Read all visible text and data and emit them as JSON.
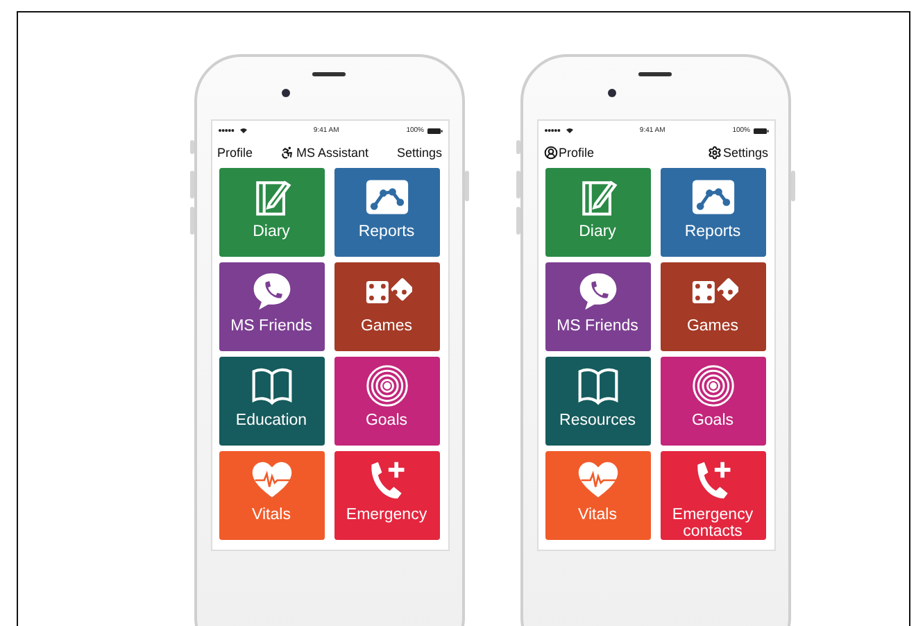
{
  "phones": [
    {
      "status": {
        "time": "9:41 AM",
        "battery": "100%"
      },
      "header": [
        {
          "text": "Profile",
          "kind": "plain"
        },
        {
          "text": "MS Assistant",
          "kind": "accessibility"
        },
        {
          "text": "Settings",
          "kind": "plain"
        }
      ],
      "tiles": [
        {
          "label": "Diary",
          "kind": "diary",
          "color": "#2a8a46"
        },
        {
          "label": "Reports",
          "kind": "chart",
          "color": "#2f6ca3"
        },
        {
          "label": "MS Friends",
          "kind": "chat",
          "color": "#7c3f92"
        },
        {
          "label": "Games",
          "kind": "dice",
          "color": "#a53a26"
        },
        {
          "label": "Education",
          "kind": "book",
          "color": "#165b5d"
        },
        {
          "label": "Goals",
          "kind": "target",
          "color": "#c3267b"
        },
        {
          "label": "Vitals",
          "kind": "heart",
          "color": "#f15b2a"
        },
        {
          "label": "Emergency",
          "kind": "phone",
          "color": "#e4263f"
        }
      ]
    },
    {
      "status": {
        "time": "9:41 AM",
        "battery": "100%"
      },
      "header": [
        {
          "text": "Profile",
          "kind": "profile"
        },
        {
          "text": "Settings",
          "kind": "gear"
        }
      ],
      "tiles": [
        {
          "label": "Diary",
          "kind": "diary",
          "color": "#2a8a46"
        },
        {
          "label": "Reports",
          "kind": "chart",
          "color": "#2f6ca3"
        },
        {
          "label": "MS Friends",
          "kind": "chat",
          "color": "#7c3f92"
        },
        {
          "label": "Games",
          "kind": "dice",
          "color": "#a53a26"
        },
        {
          "label": "Resources",
          "kind": "book",
          "color": "#165b5d"
        },
        {
          "label": "Goals",
          "kind": "target",
          "color": "#c3267b"
        },
        {
          "label": "Vitals",
          "kind": "heart",
          "color": "#f15b2a"
        },
        {
          "label": "Emergency contacts",
          "kind": "phone",
          "color": "#e4263f"
        }
      ]
    }
  ]
}
